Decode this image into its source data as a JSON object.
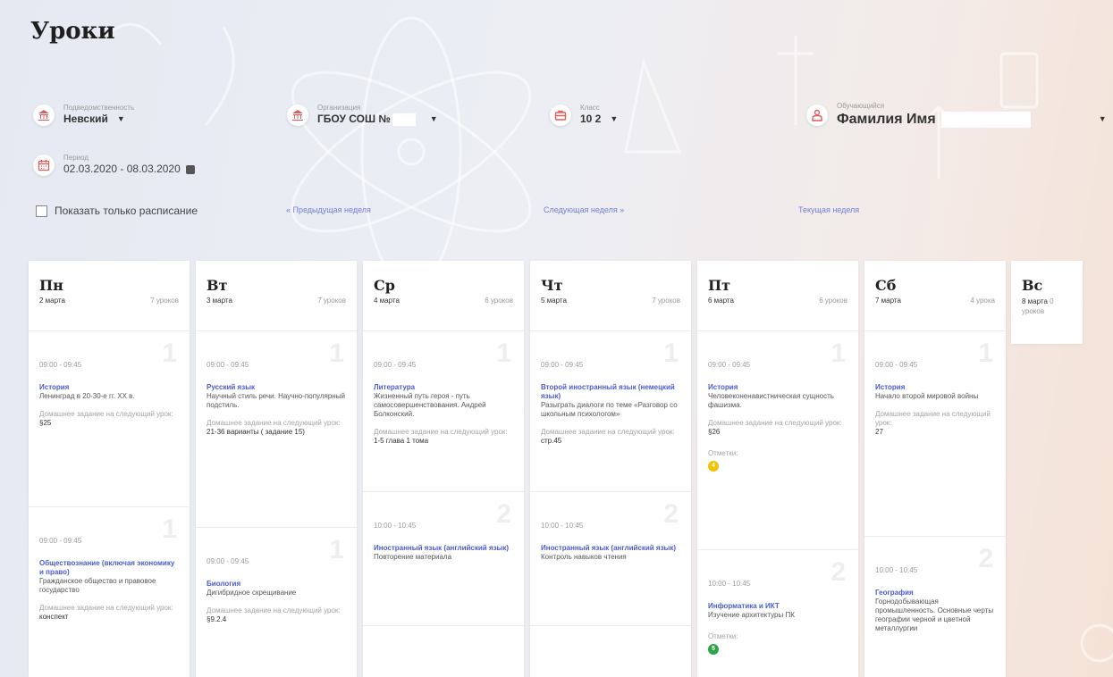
{
  "page": {
    "title": "Уроки"
  },
  "filters": {
    "district": {
      "label": "Подведомственность",
      "value": "Невский"
    },
    "organization": {
      "label": "Организация",
      "value": "ГБОУ СОШ №"
    },
    "class": {
      "label": "Класс",
      "value": "10 2"
    },
    "student": {
      "label": "Обучающийся",
      "value": "Фамилия Имя"
    },
    "period": {
      "label": "Период",
      "value": "02.03.2020 - 08.03.2020"
    }
  },
  "controls": {
    "show_schedule_only": "Показать только расписание",
    "prev_week": "« Предыдущая неделя",
    "next_week": "Следующая неделя »",
    "current_week": "Текущая неделя"
  },
  "colors": {
    "accent": "#4a5ccf",
    "icon_red": "#e45b5b",
    "mark_yellow": "#f2c200",
    "mark_green": "#2fa34a"
  },
  "days": [
    {
      "name": "Пн",
      "date": "2 марта",
      "count": "7 уроков",
      "lessons": [
        {
          "num": "1",
          "time": "09:00 - 09:45",
          "subject": "История",
          "topic": "Ленинград в 20-30-е гг. XX в.",
          "hw_label": "Домашнее задание на следующий урок:",
          "hw": "§25"
        },
        {
          "num": "1",
          "time": "09:00 - 09:45",
          "subject": "Обществознание (включая экономику и право)",
          "topic": "Гражданское общество и правовое государство",
          "hw_label": "Домашнее задание на следующий урок:",
          "hw": "конспект"
        }
      ]
    },
    {
      "name": "Вт",
      "date": "3 марта",
      "count": "7 уроков",
      "lessons": [
        {
          "num": "1",
          "time": "09:00 - 09:45",
          "subject": "Русский язык",
          "topic": "Научный стиль речи. Научно-популярный подстиль.",
          "hw_label": "Домашнее задание на следующий урок:",
          "hw": "21-36 варианты ( задание 15)"
        },
        {
          "num": "1",
          "time": "09:00 - 09:45",
          "subject": "Биология",
          "topic": "Дигибридное скрещивание",
          "hw_label": "Домашнее задание на следующий урок:",
          "hw": "§9.2.4"
        }
      ]
    },
    {
      "name": "Ср",
      "date": "4 марта",
      "count": "6 уроков",
      "lessons": [
        {
          "num": "1",
          "time": "09:00 - 09:45",
          "subject": "Литература",
          "topic": "Жизненный путь героя - путь самосовершенствования. Андрей Болконский.",
          "hw_label": "Домашнее задание на следующий урок:",
          "hw": "1-5 глава 1 тома"
        },
        {
          "num": "2",
          "time": "10:00 - 10:45",
          "subject": "Иностранный язык (английский язык)",
          "topic": "Повторение материала",
          "hw_label": "",
          "hw": ""
        }
      ]
    },
    {
      "name": "Чт",
      "date": "5 марта",
      "count": "7 уроков",
      "lessons": [
        {
          "num": "1",
          "time": "09:00 - 09:45",
          "subject": "Второй иностранный язык (немецкий язык)",
          "topic": "Разыграть диалоги по теме «Разговор со школьным психологом»",
          "hw_label": "Домашнее задание на следующий урок:",
          "hw": "стр.45"
        },
        {
          "num": "2",
          "time": "10:00 - 10:45",
          "subject": "Иностранный язык (английский язык)",
          "topic": "Контроль навыков чтения",
          "hw_label": "",
          "hw": ""
        }
      ]
    },
    {
      "name": "Пт",
      "date": "6 марта",
      "count": "6 уроков",
      "lessons": [
        {
          "num": "1",
          "time": "09:00 - 09:45",
          "subject": "История",
          "topic": "Человеконенавистническая сущность фашизма.",
          "hw_label": "Домашнее задание на следующий урок:",
          "hw": "§26",
          "marks_label": "Отметки:",
          "mark": "4"
        },
        {
          "num": "2",
          "time": "10:00 - 10:45",
          "subject": "Информатика и ИКТ",
          "topic": "Изучение архитектуры ПК",
          "hw_label": "",
          "hw": "",
          "marks_label": "Отметки:",
          "mark": "5"
        }
      ]
    },
    {
      "name": "Сб",
      "date": "7 марта",
      "count": "4 урока",
      "lessons": [
        {
          "num": "1",
          "time": "09:00 - 09:45",
          "subject": "История",
          "topic": "Начало второй мировой войны",
          "hw_label": "Домашнее задание на следующий урок:",
          "hw": "27"
        },
        {
          "num": "2",
          "time": "10:00 - 10:45",
          "subject": "География",
          "topic": "Горнодобывающая промышленность. Основные черты географии черной и цветной металлургии",
          "hw_label": "",
          "hw": ""
        }
      ]
    },
    {
      "name": "Вс",
      "date": "8 марта",
      "count": "0 уроков",
      "lessons": []
    }
  ]
}
